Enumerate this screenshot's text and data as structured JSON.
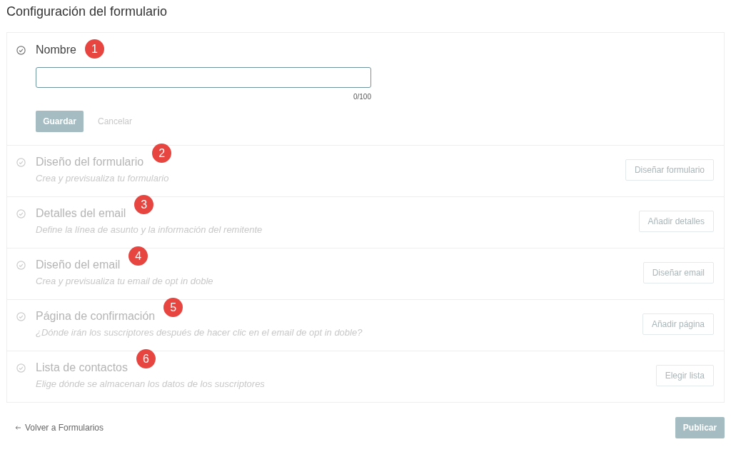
{
  "page_title": "Configuración del formulario",
  "steps": [
    {
      "title": "Nombre",
      "badge": "1",
      "expanded": true,
      "disabled": false,
      "field": {
        "counter": "0/100"
      },
      "save_label": "Guardar",
      "cancel_label": "Cancelar"
    },
    {
      "title": "Diseño del formulario",
      "badge": "2",
      "expanded": false,
      "disabled": true,
      "description": "Crea y previsualiza tu formulario",
      "action": "Diseñar formulario"
    },
    {
      "title": "Detalles del email",
      "badge": "3",
      "expanded": false,
      "disabled": true,
      "description": "Define la línea de asunto y la información del remitente",
      "action": "Añadir detalles"
    },
    {
      "title": "Diseño del email",
      "badge": "4",
      "expanded": false,
      "disabled": true,
      "description": "Crea y previsualiza tu email de opt in doble",
      "action": "Diseñar email"
    },
    {
      "title": "Página de confirmación",
      "badge": "5",
      "expanded": false,
      "disabled": true,
      "description": "¿Dónde irán los suscriptores después de hacer clic en el email de opt in doble?",
      "action": "Añadir página"
    },
    {
      "title": "Lista de contactos",
      "badge": "6",
      "expanded": false,
      "disabled": true,
      "description": "Elige dónde se almacenan los datos de los suscriptores",
      "action": "Elegir lista"
    }
  ],
  "back_link": "Volver a Formularios",
  "publish_label": "Publicar"
}
